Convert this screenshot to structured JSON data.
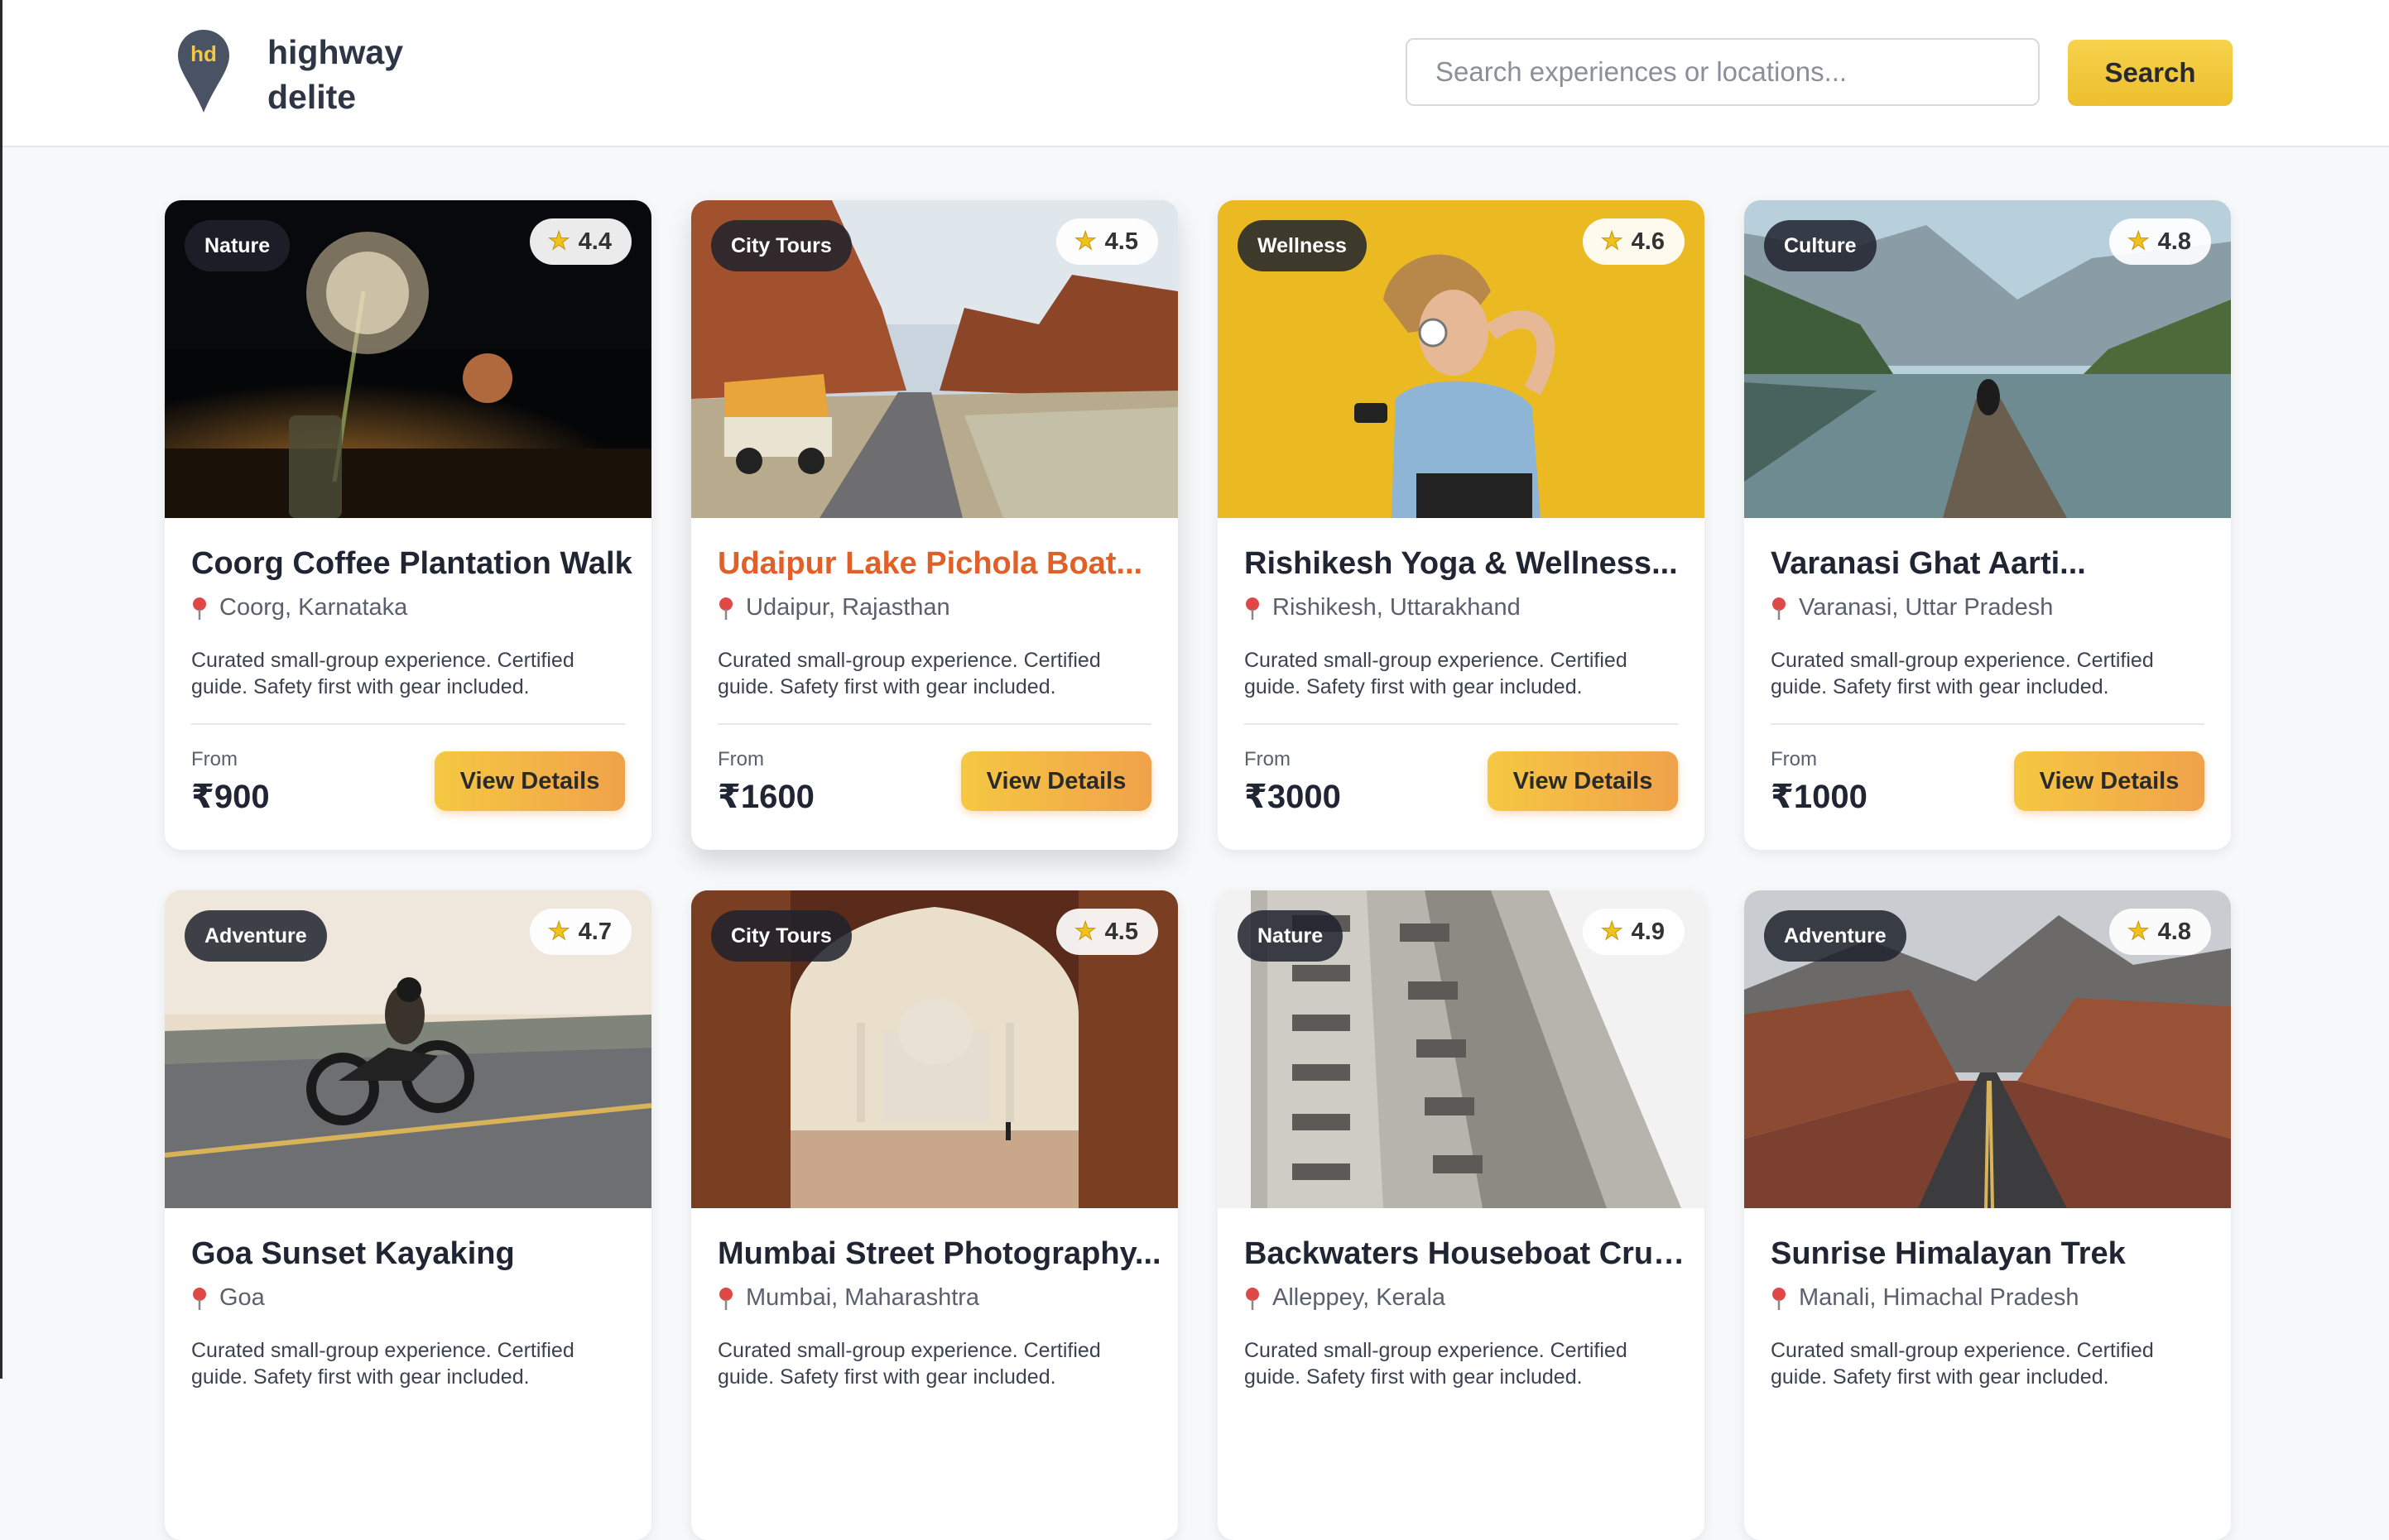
{
  "brand": {
    "monogram": "hd",
    "line1": "highway",
    "line2": "delite"
  },
  "search": {
    "placeholder": "Search experiences or locations...",
    "button_label": "Search"
  },
  "colors": {
    "accent_yellow": "#f5c842",
    "accent_orange": "#f0a24a",
    "highlight_title": "#e0602a",
    "pin_color": "#4a5364"
  },
  "cards": [
    {
      "category": "Nature",
      "rating": "4.4",
      "title": "Coorg Coffee Plantation Walk",
      "location": "Coorg, Karnataka",
      "description": "Curated small-group experience. Certified guide. Safety first with gear included.",
      "from_label": "From",
      "price": "₹900",
      "button_label": "View Details",
      "image": "dandelion-at-sunset"
    },
    {
      "category": "City Tours",
      "rating": "4.5",
      "title": "Udaipur Lake Pichola Boat...",
      "location": "Udaipur, Rajasthan",
      "description": "Curated small-group experience. Certified guide. Safety first with gear included.",
      "from_label": "From",
      "price": "₹1600",
      "button_label": "View Details",
      "image": "van-in-desert-canyon"
    },
    {
      "category": "Wellness",
      "rating": "4.6",
      "title": "Rishikesh Yoga & Wellness...",
      "location": "Rishikesh, Uttarakhand",
      "description": "Curated small-group experience. Certified guide. Safety first with gear included.",
      "from_label": "From",
      "price": "₹3000",
      "button_label": "View Details",
      "image": "woman-dancing-with-headphones"
    },
    {
      "category": "Culture",
      "rating": "4.8",
      "title": "Varanasi Ghat Aarti...",
      "location": "Varanasi, Uttar Pradesh",
      "description": "Curated small-group experience. Certified guide. Safety first with gear included.",
      "from_label": "From",
      "price": "₹1000",
      "button_label": "View Details",
      "image": "person-on-lake-pier"
    },
    {
      "category": "Adventure",
      "rating": "4.7",
      "title": "Goa Sunset Kayaking",
      "location": "Goa",
      "description": "Curated small-group experience. Certified guide. Safety first with gear included.",
      "image": "motorcyclist-on-road"
    },
    {
      "category": "City Tours",
      "rating": "4.5",
      "title": "Mumbai Street Photography...",
      "location": "Mumbai, Maharashtra",
      "description": "Curated small-group experience. Certified guide. Safety first with gear included.",
      "image": "taj-mahal-through-arch"
    },
    {
      "category": "Nature",
      "rating": "4.9",
      "title": "Backwaters Houseboat Cruise",
      "location": "Alleppey, Kerala",
      "description": "Curated small-group experience. Certified guide. Safety first with gear included.",
      "image": "apartment-building"
    },
    {
      "category": "Adventure",
      "rating": "4.8",
      "title": "Sunrise Himalayan Trek",
      "location": "Manali, Himachal Pradesh",
      "description": "Curated small-group experience. Certified guide. Safety first with gear included.",
      "image": "desert-mountain-road"
    }
  ]
}
